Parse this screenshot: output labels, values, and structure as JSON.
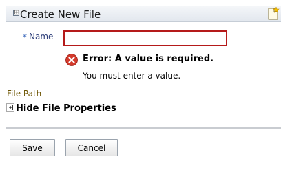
{
  "header": {
    "toggle_glyph": "⊞",
    "title": "Create New File",
    "icon": "new-file-icon"
  },
  "form": {
    "required_marker": "*",
    "name_label": "Name",
    "name_value": "",
    "file_path_label": "File Path",
    "properties_toggle_label": "Hide File Properties"
  },
  "error": {
    "icon": "error-icon",
    "title": "Error: A value is required.",
    "message": "You must enter a value."
  },
  "buttons": {
    "save": "Save",
    "cancel": "Cancel"
  },
  "colors": {
    "error_border": "#b51a1a",
    "error_icon": "#d33a2c",
    "label_blue": "#2e3f7a",
    "file_path_label": "#6b5300"
  }
}
